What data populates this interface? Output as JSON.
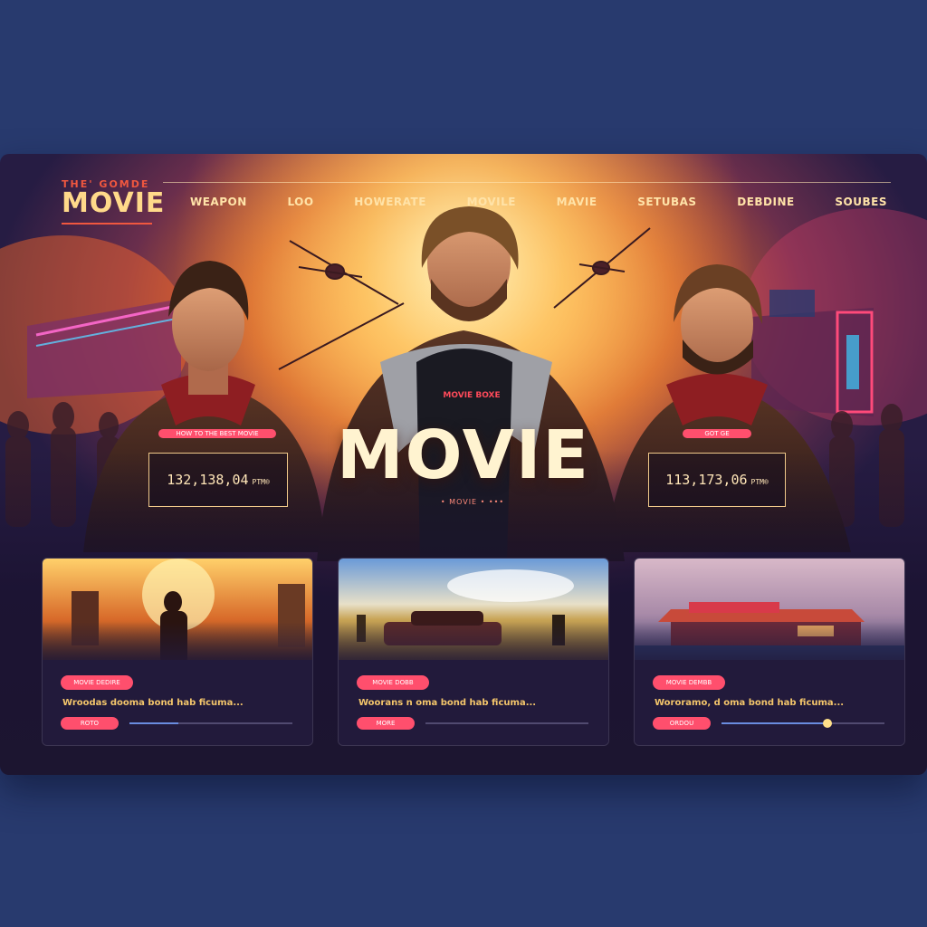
{
  "brand": {
    "top": "THE' GOMDE",
    "main": "MOVIE"
  },
  "nav": [
    "WEAPON",
    "LOO",
    "HOWERATE",
    "MOVILE",
    "MAVIE",
    "SETUBAS",
    "DEBDINE",
    "SOUBES"
  ],
  "hero": {
    "title": "MOVIE",
    "shirt_text": "MOVIE BOXE",
    "tagline": "• MOVIE • •••"
  },
  "stats": [
    {
      "tag": "HOW TO THE BEST MOVIE",
      "value": "132,138,04",
      "unit": "PTM®"
    },
    {
      "tag": "GOT GE",
      "value": "113,173,06",
      "unit": "PTM®"
    }
  ],
  "cards": [
    {
      "badge": "MOVIE DEDIRE",
      "title": "Wroodas dooma bond hab ficuma...",
      "button": "ROTO",
      "progress": 0.3
    },
    {
      "badge": "MOVIE DOBB",
      "title": "Woorans n oma bond hab ficuma...",
      "button": "MORE",
      "progress": 0
    },
    {
      "badge": "MOVIE DEMBB",
      "title": "Wororamo, d oma bond hab ficuma...",
      "button": "ORDOU",
      "progress": 0.65
    }
  ],
  "colors": {
    "background": "#283a6e",
    "accent": "#ff4f6d",
    "title": "#fff3d0",
    "gold": "#f4c66b"
  }
}
